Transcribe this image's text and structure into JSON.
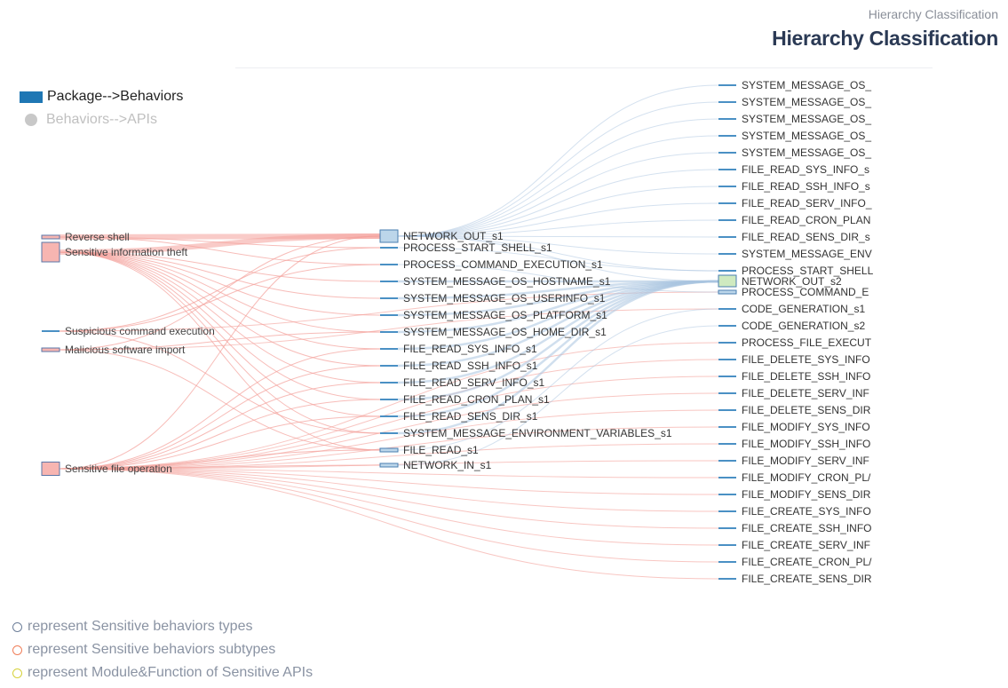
{
  "header": {
    "subtitle": "Hierarchy Classification",
    "title": "Hierarchy Classification"
  },
  "legend": {
    "items": [
      {
        "label": "Package-->Behaviors",
        "state": "active",
        "color": "#1f77b4"
      },
      {
        "label": "Behaviors-->APIs",
        "state": "inactive",
        "color": "#c8c8c8"
      }
    ]
  },
  "notes": [
    {
      "text": "represent Sensitive behaviors types",
      "color": "#6d7f99"
    },
    {
      "text": "represent Sensitive behaviors subtypes",
      "color": "#f07f5a"
    },
    {
      "text": "represent Module&Function of Sensitive APIs",
      "color": "#d6d23a"
    }
  ],
  "colors": {
    "type_node_fill": "#f7b5b1",
    "type_node_stroke": "#5b77a8",
    "api_node_fill": "#bcd6ea",
    "api_node_stroke": "#4a7fb0",
    "highlight_node_fill": "#cfeac0",
    "link_pink": "#f4a09a",
    "link_blue": "#a9c4e0",
    "bar": "#4a90c4"
  },
  "sankey": {
    "types": [
      {
        "label": "Reverse shell",
        "weight": 1
      },
      {
        "label": "Sensitive information theft",
        "weight": 4
      },
      {
        "label": "Suspicious command execution",
        "weight": 0
      },
      {
        "label": "Malicious software import",
        "weight": 1
      },
      {
        "label": "Sensitive file operation",
        "weight": 3
      }
    ],
    "apis": [
      {
        "label": "NETWORK_OUT_s1",
        "weight": 3
      },
      {
        "label": "PROCESS_START_SHELL_s1",
        "weight": 0
      },
      {
        "label": "PROCESS_COMMAND_EXECUTION_s1",
        "weight": 0
      },
      {
        "label": "SYSTEM_MESSAGE_OS_HOSTNAME_s1",
        "weight": 0
      },
      {
        "label": "SYSTEM_MESSAGE_OS_USERINFO_s1",
        "weight": 0
      },
      {
        "label": "SYSTEM_MESSAGE_OS_PLATFORM_s1",
        "weight": 0
      },
      {
        "label": "SYSTEM_MESSAGE_OS_HOME_DIR_s1",
        "weight": 0
      },
      {
        "label": "FILE_READ_SYS_INFO_s1",
        "weight": 0
      },
      {
        "label": "FILE_READ_SSH_INFO_s1",
        "weight": 0
      },
      {
        "label": "FILE_READ_SERV_INFO_s1",
        "weight": 0
      },
      {
        "label": "FILE_READ_CRON_PLAN_s1",
        "weight": 0
      },
      {
        "label": "FILE_READ_SENS_DIR_s1",
        "weight": 0
      },
      {
        "label": "SYSTEM_MESSAGE_ENVIRONMENT_VARIABLES_s1",
        "weight": 0
      },
      {
        "label": "FILE_READ_s1",
        "weight": 1
      },
      {
        "label": "NETWORK_IN_s1",
        "weight": 1
      }
    ],
    "functions": [
      {
        "label": "SYSTEM_MESSAGE_OS_",
        "weight": 0
      },
      {
        "label": "SYSTEM_MESSAGE_OS_",
        "weight": 0
      },
      {
        "label": "SYSTEM_MESSAGE_OS_",
        "weight": 0
      },
      {
        "label": "SYSTEM_MESSAGE_OS_",
        "weight": 0
      },
      {
        "label": "SYSTEM_MESSAGE_OS_",
        "weight": 0
      },
      {
        "label": "FILE_READ_SYS_INFO_s",
        "weight": 0
      },
      {
        "label": "FILE_READ_SSH_INFO_s",
        "weight": 0
      },
      {
        "label": "FILE_READ_SERV_INFO_",
        "weight": 0
      },
      {
        "label": "FILE_READ_CRON_PLAN",
        "weight": 0
      },
      {
        "label": "FILE_READ_SENS_DIR_s",
        "weight": 0
      },
      {
        "label": "SYSTEM_MESSAGE_ENV",
        "weight": 0
      },
      {
        "label": "PROCESS_START_SHELL",
        "weight": 0
      },
      {
        "label": "NETWORK_OUT_s2",
        "weight": 2
      },
      {
        "label": "PROCESS_COMMAND_E",
        "weight": 1
      },
      {
        "label": "CODE_GENERATION_s1",
        "weight": 0
      },
      {
        "label": "CODE_GENERATION_s2",
        "weight": 0
      },
      {
        "label": "PROCESS_FILE_EXECUT",
        "weight": 0
      },
      {
        "label": "FILE_DELETE_SYS_INFO",
        "weight": 0
      },
      {
        "label": "FILE_DELETE_SSH_INFO",
        "weight": 0
      },
      {
        "label": "FILE_DELETE_SERV_INF",
        "weight": 0
      },
      {
        "label": "FILE_DELETE_SENS_DIR",
        "weight": 0
      },
      {
        "label": "FILE_MODIFY_SYS_INFO",
        "weight": 0
      },
      {
        "label": "FILE_MODIFY_SSH_INFO",
        "weight": 0
      },
      {
        "label": "FILE_MODIFY_SERV_INF",
        "weight": 0
      },
      {
        "label": "FILE_MODIFY_CRON_PL/",
        "weight": 0
      },
      {
        "label": "FILE_MODIFY_SENS_DIR",
        "weight": 0
      },
      {
        "label": "FILE_CREATE_SYS_INFO",
        "weight": 0
      },
      {
        "label": "FILE_CREATE_SSH_INFO",
        "weight": 0
      },
      {
        "label": "FILE_CREATE_SERV_INF",
        "weight": 0
      },
      {
        "label": "FILE_CREATE_CRON_PL/",
        "weight": 0
      },
      {
        "label": "FILE_CREATE_SENS_DIR",
        "weight": 0
      }
    ],
    "links_type_api": [
      [
        0,
        0
      ],
      [
        0,
        1
      ],
      [
        0,
        2
      ],
      [
        1,
        0
      ],
      [
        1,
        3
      ],
      [
        1,
        4
      ],
      [
        1,
        5
      ],
      [
        1,
        6
      ],
      [
        1,
        7
      ],
      [
        1,
        8
      ],
      [
        1,
        9
      ],
      [
        1,
        10
      ],
      [
        1,
        11
      ],
      [
        1,
        12
      ],
      [
        1,
        13
      ],
      [
        2,
        1
      ],
      [
        2,
        2
      ],
      [
        2,
        12
      ],
      [
        3,
        0
      ],
      [
        3,
        6
      ],
      [
        3,
        13
      ],
      [
        4,
        0
      ],
      [
        4,
        7
      ],
      [
        4,
        8
      ],
      [
        4,
        9
      ],
      [
        4,
        10
      ],
      [
        4,
        11
      ],
      [
        4,
        13
      ],
      [
        4,
        14
      ]
    ],
    "links_api_func": [
      [
        0,
        0
      ],
      [
        0,
        1
      ],
      [
        0,
        2
      ],
      [
        0,
        3
      ],
      [
        0,
        4
      ],
      [
        0,
        5
      ],
      [
        0,
        6
      ],
      [
        0,
        7
      ],
      [
        0,
        8
      ],
      [
        0,
        9
      ],
      [
        0,
        10
      ],
      [
        0,
        11
      ],
      [
        0,
        12
      ],
      [
        1,
        11
      ],
      [
        2,
        13
      ],
      [
        3,
        12
      ],
      [
        4,
        12
      ],
      [
        5,
        12
      ],
      [
        6,
        12
      ],
      [
        7,
        12
      ],
      [
        8,
        12
      ],
      [
        9,
        12
      ],
      [
        10,
        12
      ],
      [
        11,
        12
      ],
      [
        12,
        12
      ],
      [
        13,
        14
      ],
      [
        14,
        15
      ]
    ],
    "links_type_func": [
      [
        4,
        16
      ],
      [
        4,
        17
      ],
      [
        4,
        18
      ],
      [
        4,
        19
      ],
      [
        4,
        20
      ],
      [
        4,
        21
      ],
      [
        4,
        22
      ],
      [
        4,
        23
      ],
      [
        4,
        24
      ],
      [
        4,
        25
      ],
      [
        4,
        26
      ],
      [
        4,
        27
      ],
      [
        4,
        28
      ],
      [
        4,
        29
      ],
      [
        4,
        30
      ],
      [
        3,
        14
      ],
      [
        2,
        13
      ]
    ]
  }
}
